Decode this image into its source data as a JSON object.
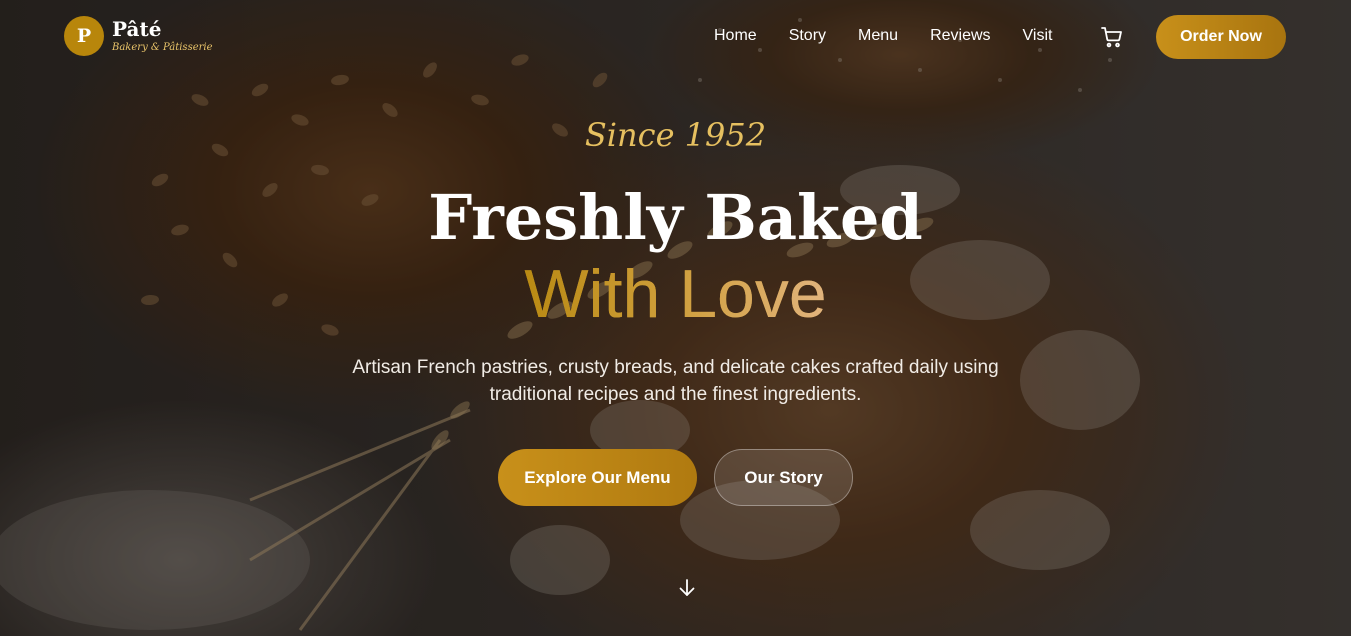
{
  "brand": {
    "mark": "P",
    "name": "Pâté",
    "tagline": "Bakery & Pâtisserie"
  },
  "nav": {
    "links": [
      "Home",
      "Story",
      "Menu",
      "Reviews",
      "Visit"
    ],
    "cart_icon": "shopping-cart-icon",
    "order_label": "Order Now"
  },
  "hero": {
    "since": "Since 1952",
    "title_line1": "Freshly Baked",
    "title_line2": "With Love",
    "subtitle": "Artisan French pastries, crusty breads, and delicate cakes crafted daily using traditional recipes and the finest ingredients.",
    "primary_button": "Explore Our Menu",
    "secondary_button": "Our Story",
    "scroll_icon": "arrow-down-icon"
  },
  "colors": {
    "accent": "#c8901a",
    "accent_light": "#e6c060",
    "overlay": "#120c08"
  }
}
